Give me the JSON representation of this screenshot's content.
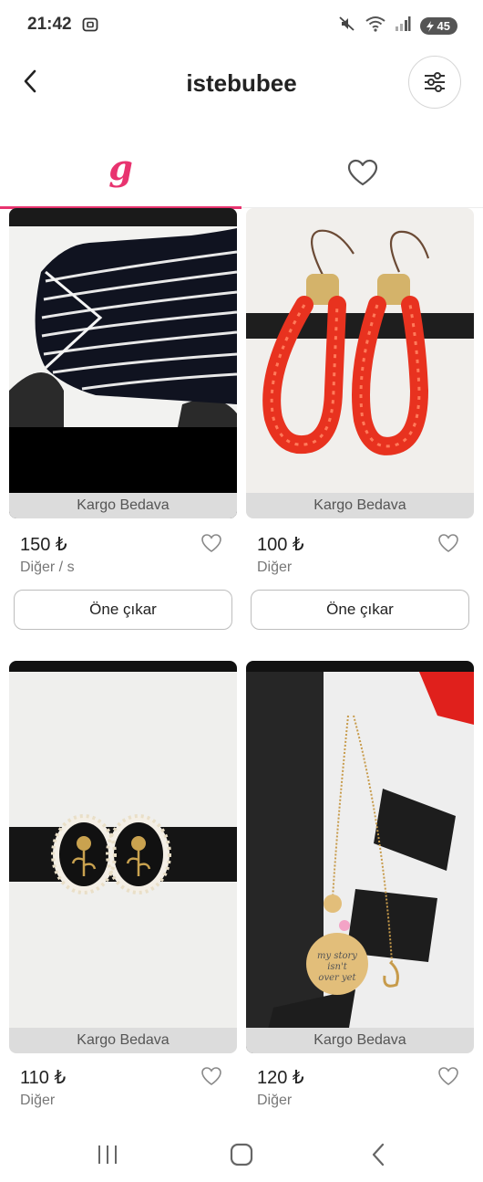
{
  "status_bar": {
    "time": "21:42",
    "battery": "45",
    "icons": [
      "screenshot-icon",
      "mute-icon",
      "wifi-icon",
      "signal-icon",
      "battery-icon"
    ]
  },
  "header": {
    "title": "istebubee",
    "back_icon": "chevron-left-icon",
    "filter_icon": "filter-sliders-icon"
  },
  "tabs": [
    {
      "label": "g",
      "icon": "brand-g-logo",
      "active": true
    },
    {
      "label": "",
      "icon": "heart-outline-icon",
      "active": false
    }
  ],
  "products": [
    {
      "badge": "Kargo Bedava",
      "price": "150 ₺",
      "category": "Diğer / s",
      "promote_label": "Öne çıkar",
      "image": "black-white-knit-top"
    },
    {
      "badge": "Kargo Bedava",
      "price": "100 ₺",
      "category": "Diğer",
      "promote_label": "Öne çıkar",
      "image": "red-mesh-earrings"
    },
    {
      "badge": "Kargo Bedava",
      "price": "110 ₺",
      "category": "Diğer",
      "image": "rose-pearl-earrings"
    },
    {
      "badge": "Kargo Bedava",
      "price": "120 ₺",
      "category": "Diğer",
      "image": "gold-pendant-necklace"
    }
  ],
  "colors": {
    "accent": "#e8336f",
    "badge_bg": "#dcdcdc",
    "text_muted": "#777777"
  },
  "nav": [
    "recents-icon",
    "home-icon",
    "back-icon"
  ]
}
